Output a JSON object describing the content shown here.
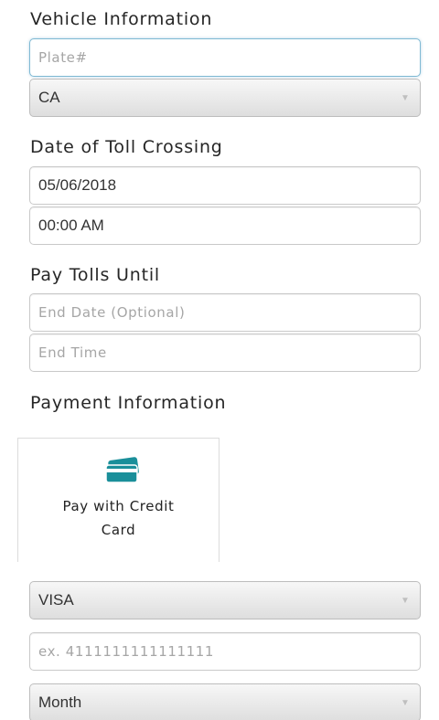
{
  "vehicle": {
    "title": "Vehicle Information",
    "plate_placeholder": "Plate#",
    "state_value": "CA"
  },
  "toll_crossing": {
    "title": "Date of Toll Crossing",
    "date_value": "05/06/2018",
    "time_value": "00:00 AM"
  },
  "pay_until": {
    "title": "Pay Tolls Until",
    "end_date_placeholder": "End Date (Optional)",
    "end_time_placeholder": "End Time"
  },
  "payment": {
    "title": "Payment Information",
    "method_label": "Pay with Credit Card",
    "method_icon": "credit-card-icon",
    "accent_color": "#1a8f9a",
    "card_type_value": "VISA",
    "card_number_placeholder": "ex. 4111111111111111",
    "month_value": "Month"
  }
}
